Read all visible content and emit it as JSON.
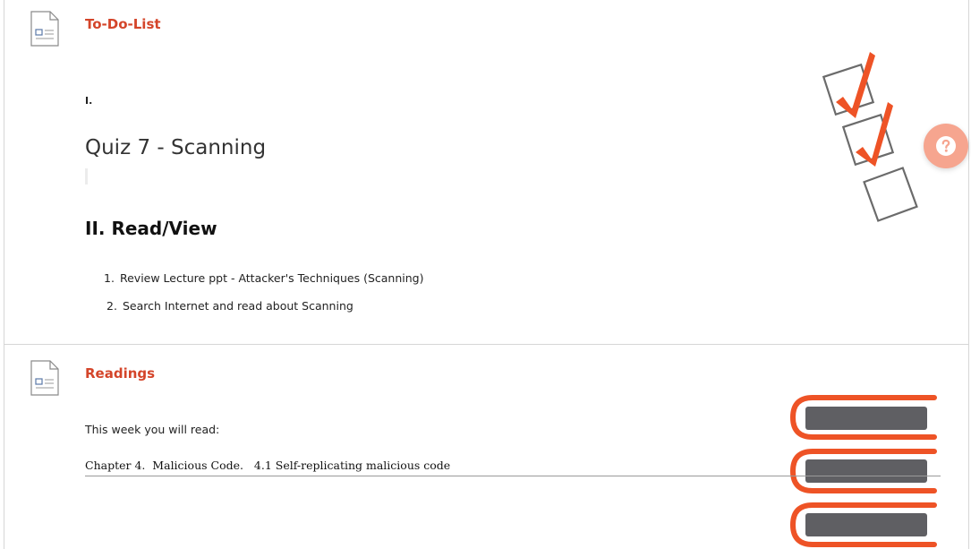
{
  "todo": {
    "title": "To-Do-List",
    "section_one_label": "I.",
    "quiz_title": "Quiz 7 - Scanning",
    "section_two_heading": "II. Read/View",
    "list_items": [
      {
        "number": "1.",
        "text": "Review Lecture ppt - Attacker's Techniques (Scanning)"
      },
      {
        "number": "2.",
        "text": "Search Internet and read about Scanning"
      }
    ]
  },
  "readings": {
    "title": "Readings",
    "intro": "This week you will read:",
    "chapter": "Chapter 4.  Malicious Code.   4.1 Self-replicating malicious code"
  },
  "icons": {
    "todo_icon": "document-icon",
    "readings_icon": "document-icon",
    "help": "question-mark-icon",
    "checklist_art": "checklist-illustration",
    "books_art": "book-stack-illustration"
  },
  "colors": {
    "accent": "#d4452a",
    "art_orange": "#ee5326",
    "art_gray": "#5f5f63",
    "help_bg": "#f6a58f"
  }
}
